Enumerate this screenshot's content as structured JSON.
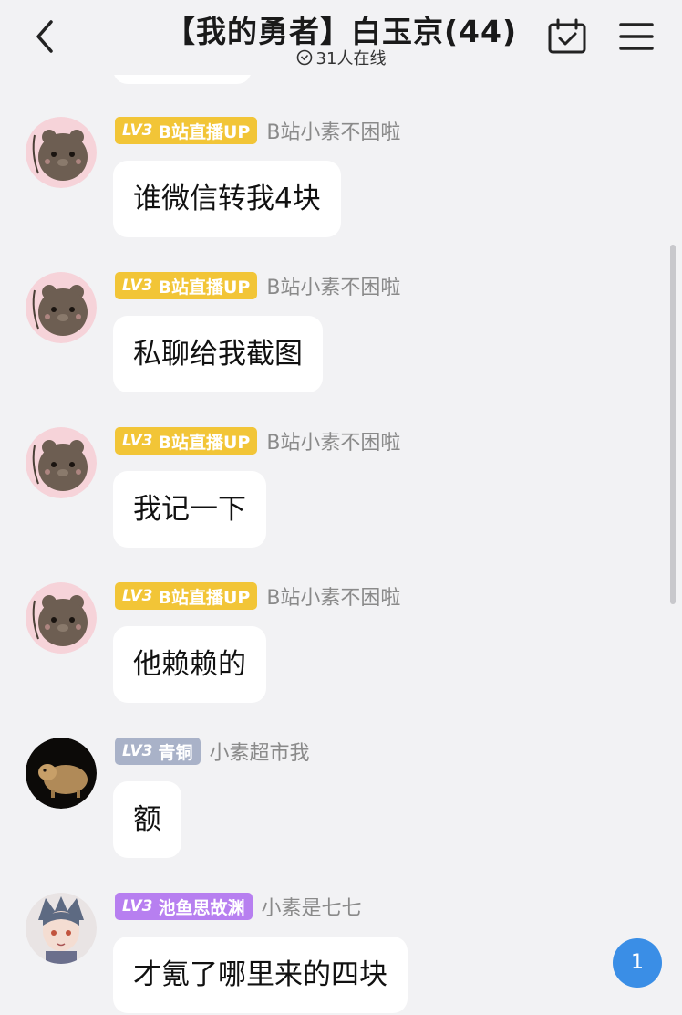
{
  "header": {
    "title": "【我的勇者】白玉京(44)",
    "online_count": "31人在线"
  },
  "colors": {
    "badge_gold": "#f2c537",
    "badge_bronze": "#a9b2c8",
    "badge_purple": "#b77ff0",
    "unread_blue": "#3a8ee6"
  },
  "messages": [
    {
      "level": "LV3",
      "title": "B站直播UP",
      "nickname": "B站小素不困啦",
      "text": "谁微信转我4块",
      "avatar": "bear-avatar"
    },
    {
      "level": "LV3",
      "title": "B站直播UP",
      "nickname": "B站小素不困啦",
      "text": "私聊给我截图",
      "avatar": "bear-avatar"
    },
    {
      "level": "LV3",
      "title": "B站直播UP",
      "nickname": "B站小素不困啦",
      "text": "我记一下",
      "avatar": "bear-avatar"
    },
    {
      "level": "LV3",
      "title": "B站直播UP",
      "nickname": "B站小素不困啦",
      "text": "他赖赖的",
      "avatar": "bear-avatar"
    },
    {
      "level": "LV3",
      "title": "青铜",
      "nickname": "小素超市我",
      "text": "额",
      "avatar": "capybara-avatar"
    },
    {
      "level": "LV3",
      "title": "池鱼思故渊",
      "nickname": "小素是七七",
      "text": "才氪了哪里来的四块",
      "avatar": "anime-avatar"
    }
  ],
  "unread_badge": "1"
}
